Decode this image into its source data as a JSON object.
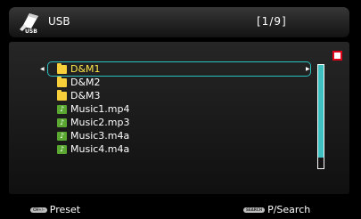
{
  "header": {
    "source_label": "USB",
    "page_indicator": "[1/9]",
    "icon": "usb-icon"
  },
  "list": {
    "selected_index": 0,
    "items": [
      {
        "label": "D&M1",
        "type": "folder"
      },
      {
        "label": "D&M2",
        "type": "folder"
      },
      {
        "label": "D&M3",
        "type": "folder"
      },
      {
        "label": "Music1.mp4",
        "type": "music"
      },
      {
        "label": "Music2.mp3",
        "type": "music"
      },
      {
        "label": "Music3.m4a",
        "type": "music"
      },
      {
        "label": "Music4.m4a",
        "type": "music"
      }
    ],
    "scroll_position_fraction": 0.0
  },
  "footer": {
    "left_button": "CH+/-",
    "left_label": "Preset",
    "right_button": "SEARCH",
    "right_label": "P/Search"
  },
  "colors": {
    "highlight_border": "#2ac0c0",
    "scroll_thumb": "#3fc0c0",
    "folder": "#f6cf3b",
    "music": "#5aa832",
    "stop_indicator": "#e0001a"
  }
}
